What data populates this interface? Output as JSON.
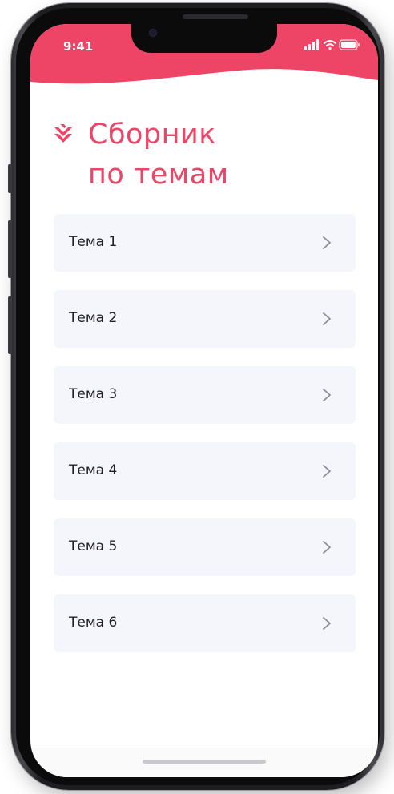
{
  "status_bar": {
    "time": "9:41",
    "icons": [
      "cellular-signal-icon",
      "wifi-icon",
      "battery-icon"
    ]
  },
  "header": {
    "logo_icon": "brand-chevron-logo-icon",
    "title_line1": "Сборник",
    "title_line2": "по темам"
  },
  "topics": [
    {
      "label": "Тема 1"
    },
    {
      "label": "Тема 2"
    },
    {
      "label": "Тема 3"
    },
    {
      "label": "Тема 4"
    },
    {
      "label": "Тема 5"
    },
    {
      "label": "Тема 6"
    }
  ],
  "colors": {
    "accent": "#ee4567",
    "card_background": "#f5f6fb",
    "text": "#1f1f24",
    "chevron": "#8a8c99"
  }
}
